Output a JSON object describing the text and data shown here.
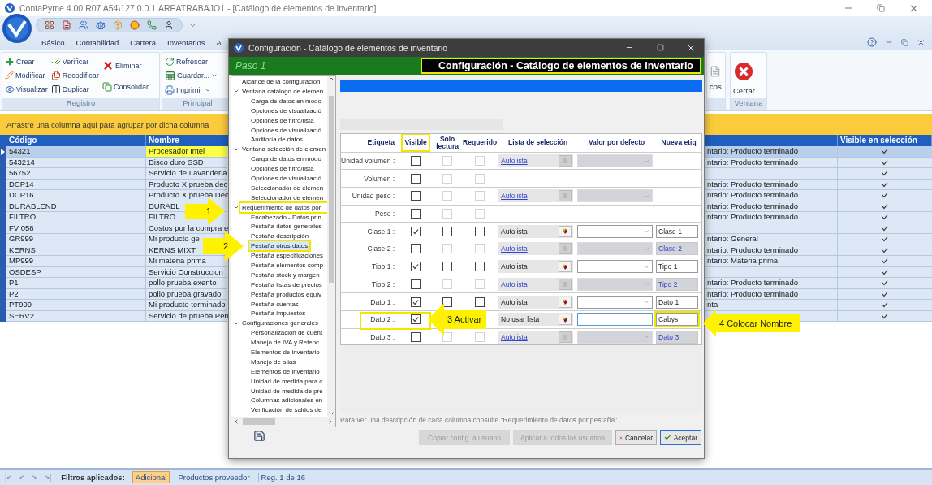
{
  "app": {
    "title": "ContaPyme 4.00 R07 A54\\127.0.0.1.AREATRABAJO1 - [Catálogo de elementos de inventario]",
    "menu": [
      "Básico",
      "Contabilidad",
      "Cartera",
      "Inventarios",
      "A"
    ],
    "ribbon": [
      {
        "label": "Registro",
        "columns": [
          [
            {
              "label": "Crear",
              "dropdown": false
            },
            {
              "label": "Modificar",
              "dropdown": false
            },
            {
              "label": "Visualizar",
              "dropdown": false
            }
          ],
          [
            {
              "label": "Verificar",
              "dropdown": false
            },
            {
              "label": "Recodificar",
              "dropdown": false
            },
            {
              "label": "Duplicar",
              "dropdown": false
            }
          ],
          [
            {
              "label": "Eliminar",
              "dropdown": false
            },
            {
              "label": "Consolidar",
              "dropdown": false
            }
          ]
        ]
      },
      {
        "label": "Principal",
        "columns": [
          [
            {
              "label": "Refrescar",
              "dropdown": false
            },
            {
              "label": "Guardar...",
              "dropdown": true
            },
            {
              "label": "Imprimir",
              "dropdown": true
            }
          ]
        ]
      },
      {
        "kind": "partial",
        "columns": [
          [
            {
              "label": "cos",
              "dropdown": false
            }
          ]
        ]
      },
      {
        "label": "Ventana",
        "kind": "large",
        "columns": [
          [
            {
              "label": "Cerrar",
              "dropdown": false
            }
          ]
        ]
      }
    ],
    "group_hint": "Arrastre una columna aquí para agrupar por dicha columna",
    "grid": {
      "columns": [
        "Código",
        "Nombre",
        "Visible en selección"
      ],
      "rows": [
        {
          "code": "54321",
          "name": "Procesador Intel",
          "column_3": "ntario: Producto terminado",
          "visible": true,
          "selected": true
        },
        {
          "code": "543214",
          "name": "Disco duro SSD",
          "column_3": "ntario: Producto terminado",
          "visible": true,
          "selected": false
        },
        {
          "code": "56752",
          "name": "Servicio de Lavanderia",
          "visible": true,
          "selected": false
        },
        {
          "code": "DCP14",
          "name": "Producto X prueba dec",
          "column_3": "ntario: Producto terminado",
          "visible": true,
          "selected": false
        },
        {
          "code": "DCP16",
          "name": "Producto X prueba Dec",
          "column_3": "ntario: Producto terminado",
          "visible": true,
          "selected": false
        },
        {
          "code": "DURABLEND",
          "name": "DURABL",
          "column_3": "ntario: Producto terminado",
          "visible": true,
          "selected": false
        },
        {
          "code": "FILTRO",
          "name": "FILTRO",
          "column_3": "ntario: Producto terminado",
          "visible": true,
          "selected": false
        },
        {
          "code": "FV 058",
          "name": "Costos por la compra e",
          "visible": true,
          "selected": false
        },
        {
          "code": "GR999",
          "name": "Mi producto ge",
          "column_3": "ntario: General",
          "visible": true,
          "selected": false
        },
        {
          "code": "KERNS",
          "name": "KERNS MIXT",
          "column_3": "ntario: Producto terminado",
          "visible": true,
          "selected": false
        },
        {
          "code": "MP999",
          "name": "Mi materia prima",
          "column_3": "ntario: Materia prima",
          "visible": true,
          "selected": false
        },
        {
          "code": "OSDESP",
          "name": "Servicio Construccion",
          "visible": true,
          "selected": false
        },
        {
          "code": "P1",
          "name": "pollo prueba exento",
          "column_3": "ntario: Producto terminado",
          "visible": true,
          "selected": false
        },
        {
          "code": "P2",
          "name": "pollo prueba gravado",
          "column_3": "ntario: Producto terminado",
          "visible": true,
          "selected": false
        },
        {
          "code": "PT999",
          "name": "Mi producto terminado",
          "column_3": "nta",
          "visible": true,
          "selected": false
        },
        {
          "code": "SERV2",
          "name": "Servicio de prueba Pen",
          "visible": true,
          "selected": false
        }
      ]
    },
    "status": {
      "nav": [
        "|<",
        "<",
        ">",
        ">|"
      ],
      "filters_label": "Filtros aplicados:",
      "filters": [
        {
          "label": "Adicional",
          "selected": true
        },
        {
          "label": "Productos proveedor",
          "selected": false
        }
      ],
      "record": "Reg. 1 de 16"
    }
  },
  "dialog": {
    "title": "Configuración - Catálogo de elementos de inventario",
    "step": "Paso 1",
    "heading": {
      "text": "Configuración - Catálogo de elementos de inventario",
      "highlighted": true
    },
    "tree": [
      {
        "label": "Alcance de la configuración",
        "selected": false,
        "highlighted": false
      },
      {
        "label": "Ventana catálogo de elemen",
        "selected": false,
        "highlighted": false,
        "expanded": true,
        "children": [
          {
            "label": "Carga de datos en modo",
            "selected": false,
            "highlighted": false
          },
          {
            "label": "Opciones de visualizació",
            "selected": false,
            "highlighted": false
          },
          {
            "label": "Opciones de filtro/lista",
            "selected": false,
            "highlighted": false
          },
          {
            "label": "Opciones de visualizació",
            "selected": false,
            "highlighted": false
          },
          {
            "label": "Auditoría de datos",
            "selected": false,
            "highlighted": false
          }
        ]
      },
      {
        "label": "Ventana selección de elemen",
        "selected": false,
        "highlighted": false,
        "expanded": true,
        "children": [
          {
            "label": "Carga de datos en modo",
            "selected": false,
            "highlighted": false
          },
          {
            "label": "Opciones de filtro/lista",
            "selected": false,
            "highlighted": false
          },
          {
            "label": "Opciones de visualizació",
            "selected": false,
            "highlighted": false
          },
          {
            "label": "Seleccionador de elemen",
            "selected": false,
            "highlighted": false
          },
          {
            "label": "Seleccionador de elemen",
            "selected": false,
            "highlighted": false
          }
        ]
      },
      {
        "label": "Requerimiento de datos por",
        "selected": false,
        "highlighted": true,
        "expanded": true,
        "children": [
          {
            "label": "Encabezado - Datos prin",
            "selected": false,
            "highlighted": false
          },
          {
            "label": "Pestaña datos generales",
            "selected": false,
            "highlighted": false
          },
          {
            "label": "Pestaña descripción",
            "selected": false,
            "highlighted": false
          },
          {
            "label": "Pestaña otros datos",
            "selected": true,
            "highlighted": true
          },
          {
            "label": "Pestaña especificaciones",
            "selected": false,
            "highlighted": false
          },
          {
            "label": "Pestaña elementos comp",
            "selected": false,
            "highlighted": false
          },
          {
            "label": "Pestaña stock y margen",
            "selected": false,
            "highlighted": false
          },
          {
            "label": "Pestaña listas de precios",
            "selected": false,
            "highlighted": false
          },
          {
            "label": "Pestaña productos equiv",
            "selected": false,
            "highlighted": false
          },
          {
            "label": "Pestaña cuentas",
            "selected": false,
            "highlighted": false
          },
          {
            "label": "Pestaña impuestos",
            "selected": false,
            "highlighted": false
          }
        ]
      },
      {
        "label": "Configuraciones generales",
        "selected": false,
        "highlighted": false,
        "expanded": true,
        "children": [
          {
            "label": "Personalización de cuent",
            "selected": false,
            "highlighted": false
          },
          {
            "label": "Manejo de IVA y Retenc",
            "selected": false,
            "highlighted": false
          },
          {
            "label": "Elementos de inventario",
            "selected": false,
            "highlighted": false
          },
          {
            "label": "Manejo de alias",
            "selected": false,
            "highlighted": false
          },
          {
            "label": "Elementos de inventario",
            "selected": false,
            "highlighted": false
          },
          {
            "label": "Unidad de medida para c",
            "selected": false,
            "highlighted": false
          },
          {
            "label": "Unidad de medida de pre",
            "selected": false,
            "highlighted": false
          },
          {
            "label": "Columnas adicionales en",
            "selected": false,
            "highlighted": false
          },
          {
            "label": "Verificación de saldos de",
            "selected": false,
            "highlighted": false
          }
        ]
      }
    ],
    "columns": [
      {
        "label": "Etiqueta",
        "highlighted": false
      },
      {
        "label": "Visible",
        "highlighted": true
      },
      {
        "label": "Solo lectura",
        "highlighted": false
      },
      {
        "label": "Requerido",
        "highlighted": false
      },
      {
        "label": "Lista de selección",
        "highlighted": false
      },
      {
        "label": "Valor por defecto",
        "highlighted": false
      },
      {
        "label": "Nueva etiq",
        "highlighted": false
      }
    ],
    "rows": [
      {
        "label": "Unidad volumen :",
        "visible": false,
        "read_only": false,
        "required": false,
        "disabled": true,
        "list": "Autolista",
        "default": {
          "kind": "combo"
        },
        "highlighted": false
      },
      {
        "label": "Volumen :",
        "visible": false,
        "read_only": false,
        "required": false,
        "disabled": true,
        "highlighted": false
      },
      {
        "label": "Unidad peso :",
        "visible": false,
        "read_only": false,
        "required": false,
        "disabled": true,
        "list": "Autolista",
        "default": {
          "kind": "combo"
        },
        "highlighted": false
      },
      {
        "label": "Peso :",
        "visible": false,
        "read_only": false,
        "required": false,
        "disabled": true,
        "highlighted": false
      },
      {
        "label": "Clase 1 :",
        "visible": true,
        "read_only": false,
        "required": false,
        "disabled": false,
        "list": "Autolista",
        "default": {
          "kind": "combo"
        },
        "new_label": {
          "text": "Clase 1",
          "highlighted": false
        },
        "highlighted": false
      },
      {
        "label": "Clase 2 :",
        "visible": false,
        "read_only": false,
        "required": false,
        "disabled": true,
        "list": "Autolista",
        "default": {
          "kind": "combo"
        },
        "new_label": {
          "text": "Clase 2",
          "highlighted": false
        },
        "highlighted": false
      },
      {
        "label": "Tipo 1 :",
        "visible": true,
        "read_only": false,
        "required": false,
        "disabled": false,
        "list": "Autolista",
        "default": {
          "kind": "combo"
        },
        "new_label": {
          "text": "Tipo 1",
          "highlighted": false
        },
        "highlighted": false
      },
      {
        "label": "Tipo 2 :",
        "visible": false,
        "read_only": false,
        "required": false,
        "disabled": true,
        "list": "Autolista",
        "default": {
          "kind": "combo"
        },
        "new_label": {
          "text": "Tipo 2",
          "highlighted": false
        },
        "highlighted": false
      },
      {
        "label": "Dato 1 :",
        "visible": true,
        "read_only": false,
        "required": false,
        "disabled": false,
        "list": "Autolista",
        "default": {
          "kind": "combo"
        },
        "new_label": {
          "text": "Dato 1",
          "highlighted": false
        },
        "highlighted": false
      },
      {
        "label": "Dato 2 :",
        "visible": true,
        "disabled": false,
        "list": "No usar lista",
        "default": {
          "kind": "text"
        },
        "new_label": {
          "text": "Cabys",
          "highlighted": true
        },
        "highlighted": true
      },
      {
        "label": "Dato 3 :",
        "visible": false,
        "read_only": false,
        "required": false,
        "disabled": true,
        "list": "Autolista",
        "default": {
          "kind": "combo"
        },
        "new_label": {
          "text": "Dato 3",
          "highlighted": false
        },
        "highlighted": false
      }
    ],
    "hint": "Para ver una descripción de cada columna consulte \"Requerimiento de datos por pestaña\".",
    "buttons": [
      {
        "label": "Copiar config. a usuario",
        "kind": "plain",
        "disabled": true
      },
      {
        "label": "Aplicar a todos los usuarios",
        "kind": "plain",
        "disabled": true
      },
      {
        "label": "Cancelar",
        "kind": "cancel",
        "disabled": false
      },
      {
        "label": "Aceptar",
        "kind": "accept",
        "disabled": false
      }
    ]
  },
  "callouts": [
    {
      "text": "1",
      "kind": "arrow-right"
    },
    {
      "text": "2",
      "kind": "arrow-right"
    },
    {
      "text": "3 Activar",
      "kind": "arrow-left"
    },
    {
      "text": "4 Colocar Nombre",
      "kind": "arrow-left"
    }
  ]
}
